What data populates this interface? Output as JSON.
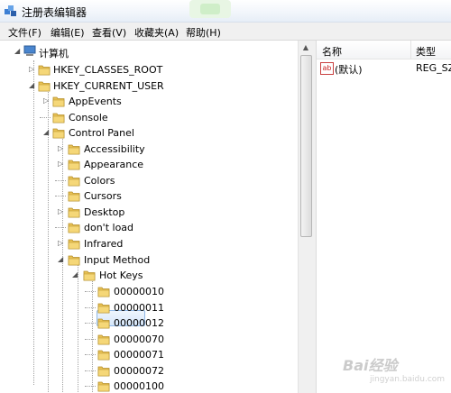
{
  "window": {
    "title": "注册表编辑器"
  },
  "menu": [
    "文件(F)",
    "编辑(E)",
    "查看(V)",
    "收藏夹(A)",
    "帮助(H)"
  ],
  "tree": {
    "root": "计算机",
    "items": [
      "HKEY_CLASSES_ROOT",
      "HKEY_CURRENT_USER",
      "AppEvents",
      "Console",
      "Control Panel",
      "Accessibility",
      "Appearance",
      "Colors",
      "Cursors",
      "Desktop",
      "don't load",
      "Infrared",
      "Input Method",
      "Hot Keys",
      "00000010",
      "00000011",
      "00000012",
      "00000070",
      "00000071",
      "00000072",
      "00000100"
    ],
    "selected": "Hot Keys"
  },
  "list": {
    "columns": [
      "名称",
      "类型"
    ],
    "rows": [
      {
        "name": "(默认)",
        "type": "REG_SZ"
      }
    ]
  },
  "watermark": {
    "text": "Bai经验",
    "sub": "jingyan.baidu.com"
  },
  "colors": {
    "folder": "#e9c255",
    "selection_border": "#8fb8e6",
    "menubar": "#f0f0f0"
  }
}
